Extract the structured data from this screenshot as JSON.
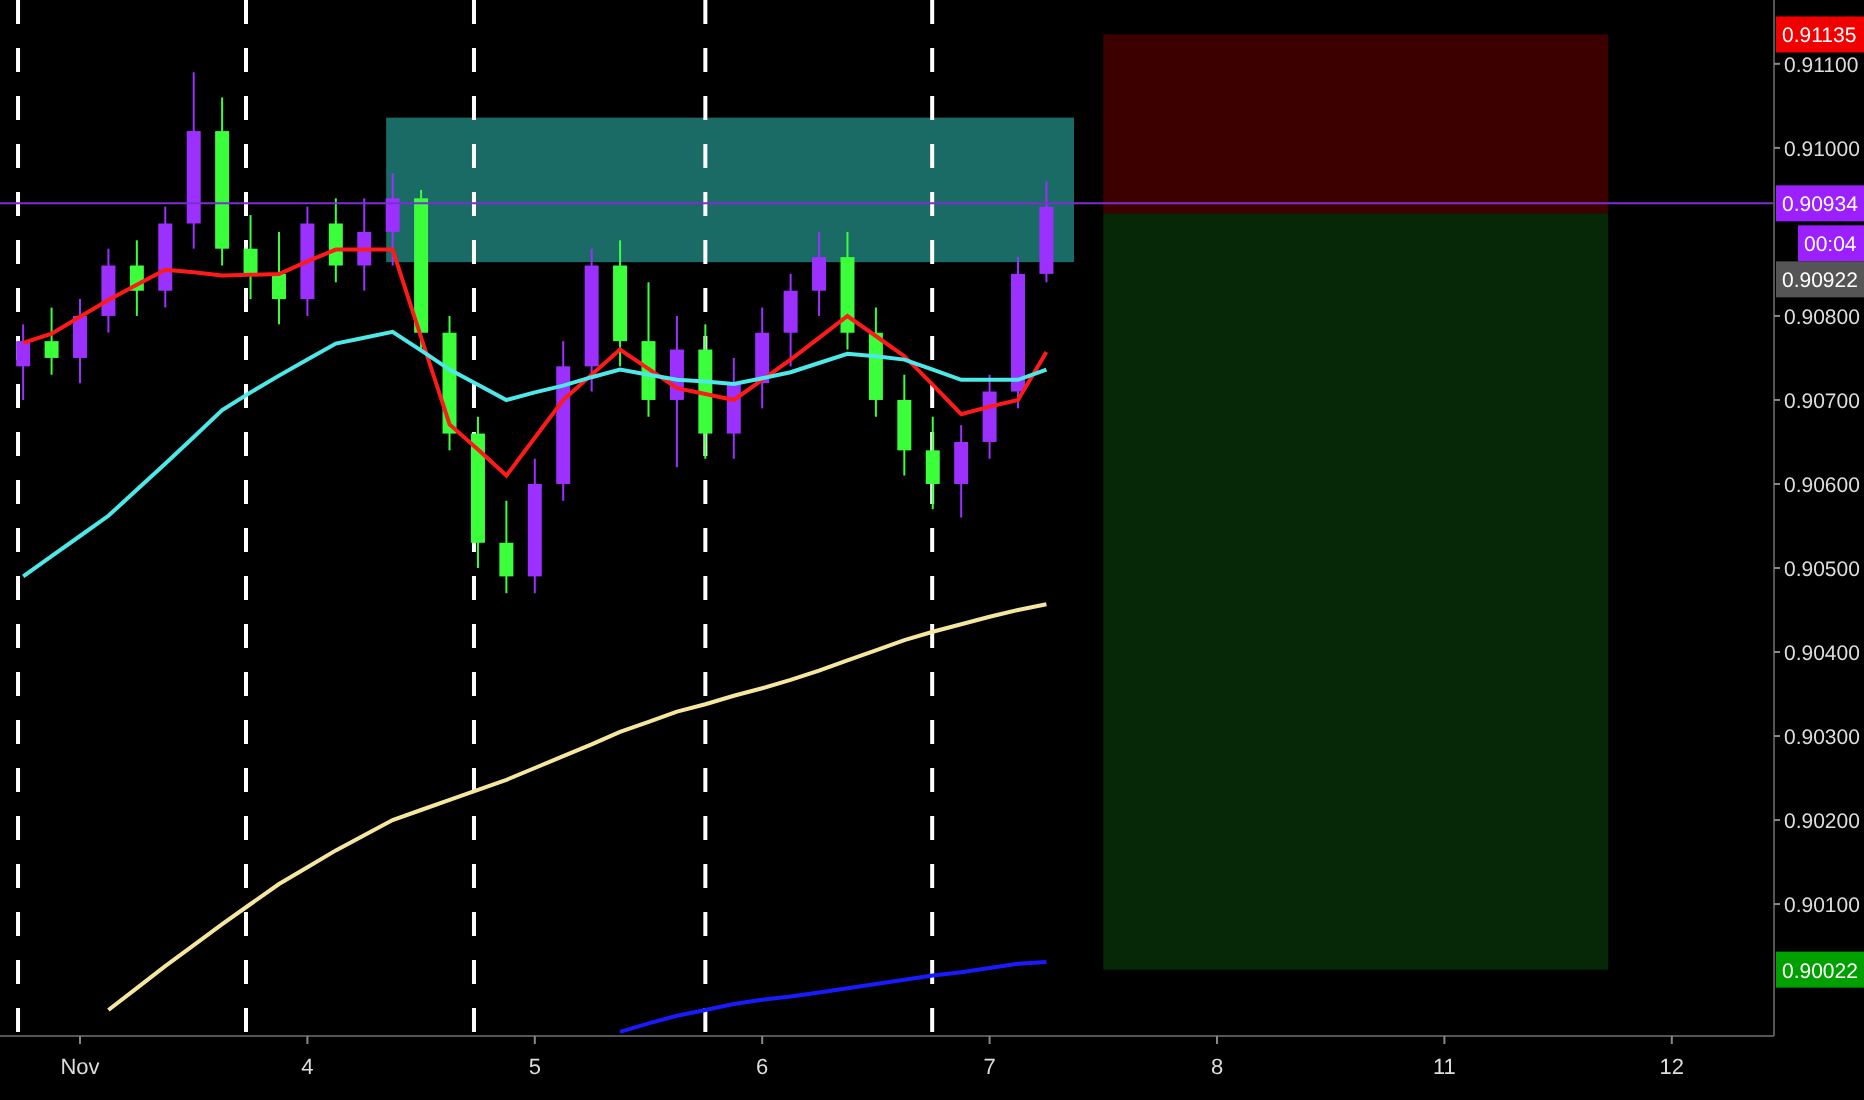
{
  "chart": {
    "chart_data": {
      "type": "candlestick",
      "categories": [
        null,
        null,
        "Nov",
        null,
        null,
        null,
        null,
        null,
        null,
        null,
        "4",
        null,
        null,
        null,
        null,
        null,
        null,
        null,
        "5",
        null,
        null,
        null,
        null,
        null,
        null,
        null,
        "6",
        null,
        null,
        null,
        null,
        null,
        null,
        null,
        "7",
        null,
        null,
        null,
        null,
        null,
        null,
        null,
        "8",
        null,
        null,
        null,
        null,
        null,
        null,
        null,
        "11",
        null,
        null,
        null,
        null,
        null,
        null,
        null,
        "12",
        null,
        null,
        null
      ],
      "ohlc": [
        [
          0.9074,
          0.9079,
          0.907,
          0.9077
        ],
        [
          0.9077,
          0.9081,
          0.9073,
          0.9075
        ],
        [
          0.9075,
          0.9082,
          0.9072,
          0.908
        ],
        [
          0.908,
          0.9088,
          0.9078,
          0.9086
        ],
        [
          0.9086,
          0.9089,
          0.908,
          0.9083
        ],
        [
          0.9083,
          0.9093,
          0.9081,
          0.9091
        ],
        [
          0.9091,
          0.9109,
          0.9088,
          0.9102
        ],
        [
          0.9102,
          0.9106,
          0.9086,
          0.9088
        ],
        [
          0.9088,
          0.9092,
          0.9082,
          0.9085
        ],
        [
          0.9085,
          0.909,
          0.9079,
          0.9082
        ],
        [
          0.9082,
          0.9093,
          0.908,
          0.9091
        ],
        [
          0.9091,
          0.9094,
          0.9084,
          0.9086
        ],
        [
          0.9086,
          0.9094,
          0.9083,
          0.909
        ],
        [
          0.909,
          0.9097,
          0.9086,
          0.9094
        ],
        [
          0.9094,
          0.9095,
          0.9076,
          0.9078
        ],
        [
          0.9078,
          0.908,
          0.9064,
          0.9066
        ],
        [
          0.9066,
          0.9068,
          0.905,
          0.9053
        ],
        [
          0.9053,
          0.9058,
          0.9047,
          0.9049
        ],
        [
          0.9049,
          0.9063,
          0.9047,
          0.906
        ],
        [
          0.906,
          0.9077,
          0.9058,
          0.9074
        ],
        [
          0.9074,
          0.9088,
          0.9071,
          0.9086
        ],
        [
          0.9086,
          0.9089,
          0.9074,
          0.9077
        ],
        [
          0.9077,
          0.9084,
          0.9068,
          0.907
        ],
        [
          0.907,
          0.908,
          0.9062,
          0.9076
        ],
        [
          0.9076,
          0.9079,
          0.9063,
          0.9066
        ],
        [
          0.9066,
          0.9075,
          0.9063,
          0.9072
        ],
        [
          0.9072,
          0.9081,
          0.9069,
          0.9078
        ],
        [
          0.9078,
          0.9085,
          0.9074,
          0.9083
        ],
        [
          0.9083,
          0.909,
          0.908,
          0.9087
        ],
        [
          0.9087,
          0.909,
          0.9076,
          0.9078
        ],
        [
          0.9078,
          0.9081,
          0.9068,
          0.907
        ],
        [
          0.907,
          0.9073,
          0.9061,
          0.9064
        ],
        [
          0.9064,
          0.9068,
          0.9057,
          0.906
        ],
        [
          0.906,
          0.9067,
          0.9056,
          0.9065
        ],
        [
          0.9065,
          0.9073,
          0.9063,
          0.9071
        ],
        [
          0.9071,
          0.9087,
          0.9069,
          0.9085
        ],
        [
          0.9085,
          0.9096,
          0.9084,
          0.9093
        ],
        null,
        null,
        null,
        null,
        null,
        null,
        null,
        null,
        null,
        null,
        null,
        null,
        null,
        null,
        null,
        null,
        null,
        null,
        null,
        null,
        null,
        null,
        null,
        null,
        null
      ],
      "series": [
        {
          "type": "line",
          "color": "#ff1a1a",
          "values": [
            0.90768,
            0.90779,
            0.90799,
            0.90819,
            0.90837,
            0.90855,
            0.90852,
            0.90848,
            0.90849,
            0.9085,
            0.90865,
            0.90879,
            0.90879,
            0.90879,
            0.90775,
            0.90671,
            0.90641,
            0.9061,
            0.90655,
            0.907,
            0.9073,
            0.9076,
            0.90737,
            0.90714,
            0.90707,
            0.907,
            0.90724,
            0.90748,
            0.90774,
            0.908,
            0.90776,
            0.90752,
            0.90718,
            0.90683,
            0.90692,
            0.907,
            0.90757,
            null,
            null,
            null,
            null,
            null,
            null,
            null,
            null,
            null,
            null,
            null,
            null,
            null,
            null,
            null,
            null,
            null,
            null,
            null,
            null,
            null,
            null,
            null,
            null,
            null
          ]
        },
        {
          "type": "line",
          "color": "#4de8e8",
          "values": [
            0.9049,
            0.90514,
            0.90538,
            0.90562,
            0.90593,
            0.90624,
            0.90656,
            0.90688,
            0.90709,
            0.90729,
            0.90748,
            0.90767,
            0.90774,
            0.90781,
            0.90759,
            0.90736,
            0.90718,
            0.907,
            0.90709,
            0.90717,
            0.90727,
            0.90736,
            0.9073,
            0.90724,
            0.90722,
            0.90719,
            0.90726,
            0.90733,
            0.90744,
            0.90755,
            0.90752,
            0.90748,
            0.90736,
            0.90724,
            0.90724,
            0.90724,
            0.90736,
            null,
            null,
            null,
            null,
            null,
            null,
            null,
            null,
            null,
            null,
            null,
            null,
            null,
            null,
            null,
            null,
            null,
            null,
            null,
            null,
            null,
            null,
            null,
            null,
            null
          ]
        },
        {
          "type": "line",
          "color": "#f5e6a0",
          "values": [
            null,
            null,
            null,
            0.89974,
            0.9,
            0.90026,
            0.90051,
            0.90076,
            0.901,
            0.90124,
            0.90144,
            0.90164,
            0.90182,
            0.902,
            0.90212,
            0.90224,
            0.90236,
            0.90248,
            0.90262,
            0.90276,
            0.9029,
            0.90305,
            0.90317,
            0.90329,
            0.90338,
            0.90348,
            0.90357,
            0.90367,
            0.90378,
            0.9039,
            0.90402,
            0.90414,
            0.90424,
            0.90433,
            0.90442,
            0.9045,
            0.90457,
            null,
            null,
            null,
            null,
            null,
            null,
            null,
            null,
            null,
            null,
            null,
            null,
            null,
            null,
            null,
            null,
            null,
            null,
            null,
            null,
            null,
            null,
            null,
            null,
            null
          ]
        },
        {
          "type": "line",
          "color": "#1a1aff",
          "values": [
            null,
            null,
            null,
            null,
            null,
            null,
            null,
            null,
            null,
            null,
            null,
            null,
            null,
            null,
            null,
            null,
            null,
            null,
            null,
            null,
            null,
            0.89948,
            0.89958,
            0.89967,
            0.89974,
            0.89981,
            0.89986,
            0.8999,
            0.89995,
            0.9,
            0.90005,
            0.9001,
            0.90015,
            0.90019,
            0.90024,
            0.90029,
            0.90031,
            null,
            null,
            null,
            null,
            null,
            null,
            null,
            null,
            null,
            null,
            null,
            null,
            null,
            null,
            null,
            null,
            null,
            null,
            null,
            null,
            null,
            null,
            null,
            null,
            null
          ]
        }
      ],
      "grid": true,
      "ylim": [
        0.89943,
        0.91176
      ],
      "yticks": [
        {
          "value": 0.911,
          "label": "0.91100"
        },
        {
          "value": 0.91,
          "label": "0.91000"
        },
        {
          "value": 0.908,
          "label": "0.90800"
        },
        {
          "value": 0.907,
          "label": "0.90700"
        },
        {
          "value": 0.906,
          "label": "0.90600"
        },
        {
          "value": 0.905,
          "label": "0.90500"
        },
        {
          "value": 0.904,
          "label": "0.90400"
        },
        {
          "value": 0.903,
          "label": "0.90300"
        },
        {
          "value": 0.902,
          "label": "0.90200"
        },
        {
          "value": 0.901,
          "label": "0.90100"
        }
      ],
      "ref_lines": [
        {
          "axis": "y",
          "value": 0.90934,
          "color": "#7b2fd0"
        }
      ],
      "bands": [
        {
          "axis": "y",
          "from": 0.90864,
          "to": 0.91036,
          "color": "#1a6b66"
        },
        {
          "axis": "y",
          "from": 0.90922,
          "to": 0.91135,
          "color": "#3d0000"
        },
        {
          "axis": "y",
          "from": 0.90022,
          "to": 0.90922,
          "color": "#062806"
        }
      ],
      "annotations": [
        {
          "y": 0.91135,
          "text": "0.91135"
        },
        {
          "y": 0.90934,
          "text": "0.90934"
        },
        "0.90922",
        {
          "y": 0.90022,
          "text": "0.90022"
        }
      ]
    },
    "price_tags": [
      {
        "color": "#f20000"
      },
      {
        "color": "#9c1fff"
      },
      {
        "color": "#555555"
      },
      {
        "color": "#00a000"
      }
    ],
    "countdown": {
      "text": "00:04",
      "color": "#9c1fff"
    }
  }
}
